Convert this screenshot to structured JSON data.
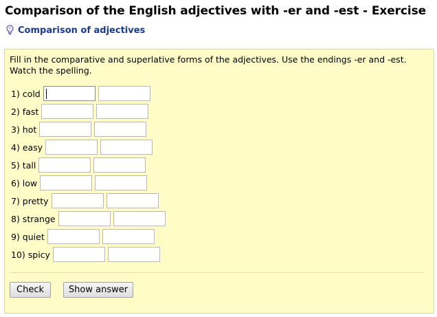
{
  "page": {
    "title": "Comparison of the English adjectives with -er and -est - Exercise",
    "sublink": "Comparison of adjectives",
    "sublink_icon": "lightbulb-icon"
  },
  "exercise": {
    "instructions": "Fill in the comparative and superlative forms of the adjectives. Use the endings -er and -est. Watch the spelling.",
    "items": [
      {
        "label": "1) cold",
        "comparative": "",
        "superlative": ""
      },
      {
        "label": "2) fast",
        "comparative": "",
        "superlative": ""
      },
      {
        "label": "3) hot",
        "comparative": "",
        "superlative": ""
      },
      {
        "label": "4) easy",
        "comparative": "",
        "superlative": ""
      },
      {
        "label": "5) tall",
        "comparative": "",
        "superlative": ""
      },
      {
        "label": "6) low",
        "comparative": "",
        "superlative": ""
      },
      {
        "label": "7) pretty",
        "comparative": "",
        "superlative": ""
      },
      {
        "label": "8) strange",
        "comparative": "",
        "superlative": ""
      },
      {
        "label": "9) quiet",
        "comparative": "",
        "superlative": ""
      },
      {
        "label": "10) spicy",
        "comparative": "",
        "superlative": ""
      }
    ],
    "check_label": "Check",
    "show_answer_label": "Show answer"
  },
  "colors": {
    "exercise_bg": "#fffcc8",
    "link": "#1a3a8f"
  }
}
